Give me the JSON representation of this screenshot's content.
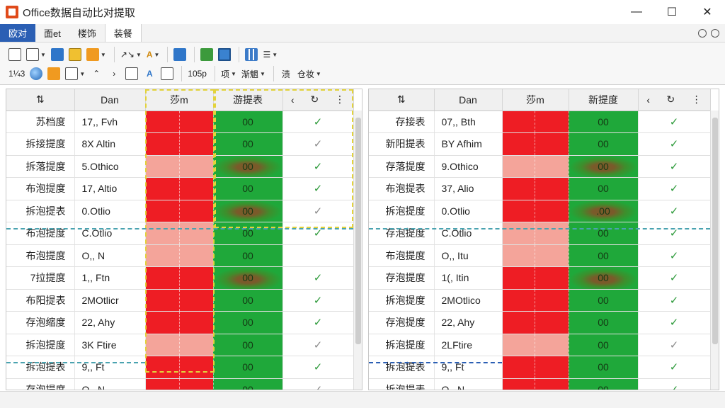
{
  "window": {
    "title": "Office数据自动比对提取",
    "controls": [
      "—",
      "☐",
      "✕"
    ]
  },
  "menu": {
    "tabs": [
      {
        "label": "欧对",
        "style": "active-blue"
      },
      {
        "label": "面et",
        "style": ""
      },
      {
        "label": "楼饰",
        "style": ""
      },
      {
        "label": "装餐",
        "style": "selected"
      }
    ]
  },
  "toolbar": {
    "row1_icons": [
      "new-doc-icon",
      "open-doc-icon",
      "export-icon",
      "edit-icon",
      "fill-color-icon",
      "arrows-icon",
      "text-color-icon",
      "link-icon",
      "table-green-icon",
      "monitor-icon",
      "grid-icon",
      "list-icon"
    ],
    "row2_labels": {
      "num": "1¼3",
      "zoom": "105p",
      "item": "项",
      "compare": "渐魍",
      "filter": "渍",
      "sort": "仓妆"
    }
  },
  "left_table": {
    "headers": [
      "Dan",
      "莎m",
      "游提表"
    ],
    "rows": [
      {
        "name": "苏档度",
        "value": "17,, Fvh",
        "c1": "red-strong",
        "c2": "00",
        "c2_style": "",
        "check": "green"
      },
      {
        "name": "拆接提度",
        "value": "8X Altin",
        "c1": "red-strong",
        "c2": "00",
        "c2_style": "",
        "check": "grey"
      },
      {
        "name": "拆落提度",
        "value": "5.Othico",
        "c1": "red-light",
        "c2": "00",
        "c2_style": "smudge",
        "check": "green"
      },
      {
        "name": "布泡提度",
        "value": "17, Altio",
        "c1": "red-strong",
        "c2": "00",
        "c2_style": "",
        "check": "green"
      },
      {
        "name": "拆泡提表",
        "value": "0.Otlio",
        "c1": "red-strong",
        "c2": "00",
        "c2_style": "smudge",
        "check": "grey"
      },
      {
        "name": "布泡提度",
        "value": "C.Otlio",
        "c1": "red-light",
        "c2": "00",
        "c2_style": "",
        "check": "green"
      },
      {
        "name": "布泡提度",
        "value": "O,, N",
        "c1": "red-light",
        "c2": "00",
        "c2_style": "",
        "check": "none"
      },
      {
        "name": "7拉提度",
        "value": "1,, Ftn",
        "c1": "red-strong",
        "c2": "00",
        "c2_style": "smudge",
        "check": "green"
      },
      {
        "name": "布阳提表",
        "value": "2MOtlicr",
        "c1": "red-strong",
        "c2": "00",
        "c2_style": "",
        "check": "green"
      },
      {
        "name": "存泡缩度",
        "value": "22, Ahy",
        "c1": "red-strong",
        "c2": "00",
        "c2_style": "",
        "check": "green"
      },
      {
        "name": "拆泡提度",
        "value": "3K Ftire",
        "c1": "red-light",
        "c2": "00",
        "c2_style": "",
        "check": "grey"
      },
      {
        "name": "拆泡提表",
        "value": "9,, Ft",
        "c1": "red-strong",
        "c2": "00",
        "c2_style": "",
        "check": "green"
      },
      {
        "name": "存泡提度",
        "value": "O,, N",
        "c1": "red-strong",
        "c2": "00",
        "c2_style": "",
        "check": "grey"
      }
    ]
  },
  "right_table": {
    "headers": [
      "Dan",
      "莎m",
      "新提度"
    ],
    "rows": [
      {
        "name": "存接表",
        "value": "07,, Bth",
        "c1": "red-strong",
        "c2": "00",
        "c2_style": "",
        "check": "green"
      },
      {
        "name": "新阳提表",
        "value": "BY Afhim",
        "c1": "red-strong",
        "c2": "00",
        "c2_style": "",
        "check": "green"
      },
      {
        "name": "存落提度",
        "value": "9.Othico",
        "c1": "red-light",
        "c2": "00",
        "c2_style": "smudge",
        "check": "green"
      },
      {
        "name": "布泡提表",
        "value": "37, Alio",
        "c1": "red-strong",
        "c2": "00",
        "c2_style": "",
        "check": "green"
      },
      {
        "name": "拆泡提度",
        "value": "0.Otlio",
        "c1": "red-strong",
        "c2": ".00",
        "c2_style": "smudge",
        "check": "green"
      },
      {
        "name": "存泡提度",
        "value": "C.Otlio",
        "c1": "red-light",
        "c2": "00",
        "c2_style": "",
        "check": "green"
      },
      {
        "name": "布泡提度",
        "value": "O,, Itu",
        "c1": "red-light",
        "c2": "00",
        "c2_style": "",
        "check": "green"
      },
      {
        "name": "存泡提度",
        "value": "1(, Itin",
        "c1": "red-strong",
        "c2": "00",
        "c2_style": "smudge",
        "check": "green"
      },
      {
        "name": "拆泡提度",
        "value": "2MOtlico",
        "c1": "red-strong",
        "c2": "00",
        "c2_style": "",
        "check": "green"
      },
      {
        "name": "存泡提度",
        "value": "22, Ahy",
        "c1": "red-strong",
        "c2": "00",
        "c2_style": "",
        "check": "green"
      },
      {
        "name": "拆泡提度",
        "value": "2LFtire",
        "c1": "red-light",
        "c2": "00",
        "c2_style": "",
        "check": "grey"
      },
      {
        "name": "拆泡提表",
        "value": "9,, Ft",
        "c1": "red-strong",
        "c2": "00",
        "c2_style": "",
        "check": "green"
      },
      {
        "name": "拆泡提表",
        "value": "O,, N",
        "c1": "red-strong",
        "c2": "00",
        "c2_style": "",
        "check": "green"
      }
    ]
  },
  "colors": {
    "title_accent": "#2b5fb4",
    "red_strong": "#ee1d24",
    "red_light": "#f4a49a",
    "green": "#1fa83a",
    "check": "#2d9a3a"
  }
}
